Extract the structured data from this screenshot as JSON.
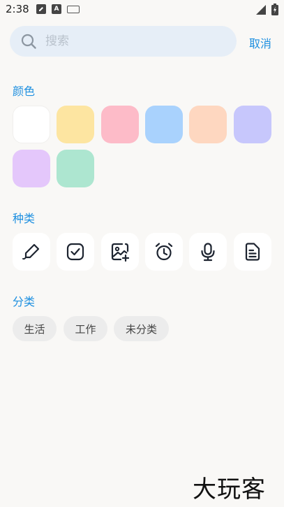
{
  "status_bar": {
    "time": "2:38",
    "left_icons": [
      "edit-app-icon",
      "a-box-icon",
      "keyboard-icon"
    ],
    "right_icons": [
      "signal-icon",
      "battery-icon"
    ]
  },
  "search": {
    "placeholder": "搜索",
    "value": "",
    "cancel_label": "取消"
  },
  "colors_section": {
    "title": "颜色",
    "swatches": [
      "#ffffff",
      "#fde5a1",
      "#fdbbc8",
      "#a9d2fd",
      "#fed7c0",
      "#c7c7fc",
      "#e4c7fb",
      "#ade6d0"
    ]
  },
  "types_section": {
    "title": "种类",
    "items": [
      "pen-icon",
      "checkbox-icon",
      "image-add-icon",
      "alarm-clock-icon",
      "microphone-icon",
      "document-icon"
    ]
  },
  "category_section": {
    "title": "分类",
    "chips": [
      "生活",
      "工作",
      "未分类"
    ]
  },
  "watermark": "大玩客",
  "accent_color": "#1d8fe0"
}
